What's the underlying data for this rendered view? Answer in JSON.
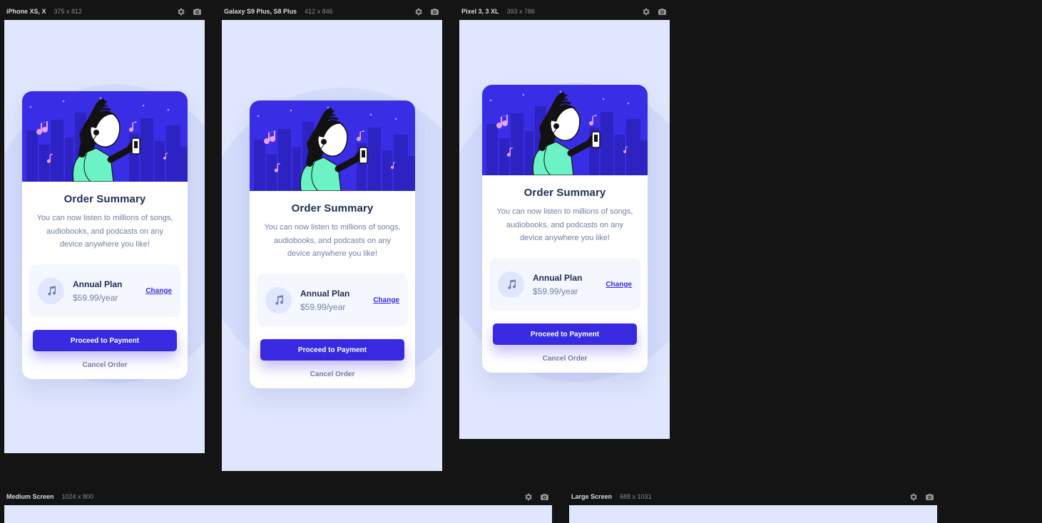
{
  "devices": [
    {
      "id": "iphone",
      "name": "iPhone XS, X",
      "dims": "375 x 812"
    },
    {
      "id": "galaxy",
      "name": "Galaxy S9 Plus, S8 Plus",
      "dims": "412 x 846"
    },
    {
      "id": "pixel",
      "name": "Pixel 3, 3 XL",
      "dims": "393 x 786"
    },
    {
      "id": "medium",
      "name": "Medium Screen",
      "dims": "1024 x 800"
    },
    {
      "id": "large",
      "name": "Large Screen",
      "dims": "688 x 1031"
    }
  ],
  "card": {
    "title": "Order Summary",
    "description": "You can now listen to millions of songs, audiobooks, and podcasts on any device anywhere you like!",
    "plan_name": "Annual Plan",
    "plan_price": "$59.99/year",
    "change_label": "Change",
    "proceed_label": "Proceed to Payment",
    "cancel_label": "Cancel Order"
  },
  "icons": {
    "settings": "gear-icon",
    "screenshot": "camera-icon",
    "plan": "music-note-icon"
  },
  "colors": {
    "app_background": "#141414",
    "viewport_background": "#dfe6fd",
    "accent": "#382ae1",
    "hero_background": "#3a2de6",
    "title": "#1f2f56",
    "muted_text": "#717fa6"
  }
}
